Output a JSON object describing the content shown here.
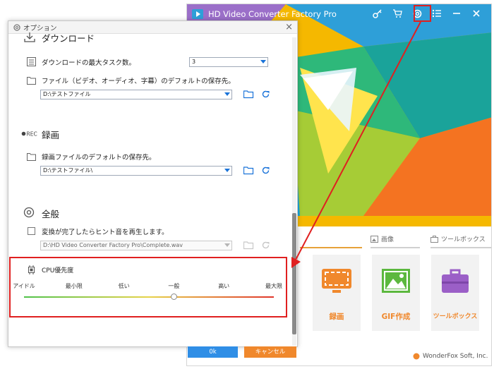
{
  "app": {
    "title": "HD Video Converter Factory Pro",
    "categories": [
      {
        "label": "画像",
        "icon": "image-icon"
      },
      {
        "label": "ツールボックス",
        "icon": "toolbox-icon"
      }
    ],
    "tiles": [
      {
        "label": "録画",
        "color": "#f0882c"
      },
      {
        "label": "GIF作成",
        "color": "#f0882c"
      },
      {
        "label": "ツールボックス",
        "color": "#f0882c"
      }
    ],
    "footer": "WonderFox Soft, Inc."
  },
  "dialog": {
    "title": "オプション",
    "download": {
      "title": "ダウンロード",
      "max_tasks_label": "ダウンロードの最大タスク数。",
      "max_tasks_value": "3",
      "save_label": "ファイル（ビデオ、オーディオ、字幕）のデフォルトの保存先。",
      "save_path": "D:\\テストファイル"
    },
    "record": {
      "title": "録画",
      "rec_badge": "●REC",
      "save_label": "録画ファイルのデフォルトの保存先。",
      "save_path": "D:\\テストファイル\\"
    },
    "general": {
      "title": "全般",
      "hint_label": "変換が完了したらヒント音を再生します。",
      "hint_checked": false,
      "sound_path": "D:\\HD Video Converter Factory Pro\\Complete.wav"
    },
    "cpu": {
      "title": "CPU優先度",
      "ticks": [
        "アイドル",
        "最小限",
        "低い",
        "一般",
        "高い",
        "最大限"
      ],
      "selected": "一般"
    },
    "ok_label": "0k",
    "cancel_label": "キャンセル"
  },
  "colors": {
    "accent_red": "#e02020",
    "ok_button": "#2f8ee6",
    "cancel_button": "#f0882c"
  }
}
